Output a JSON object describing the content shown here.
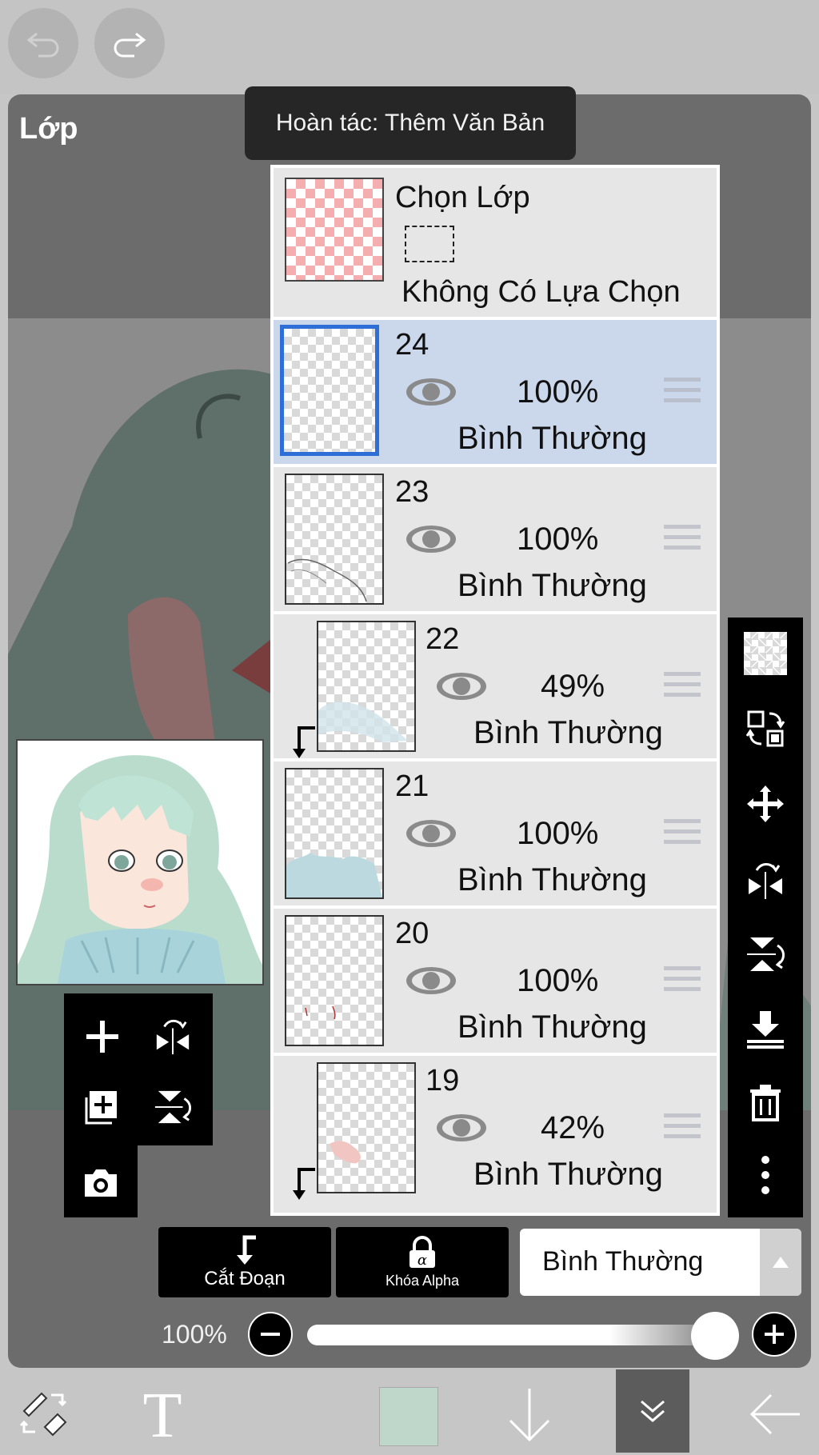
{
  "toolbar_top": {
    "undo_icon": "undo-icon",
    "redo_icon": "redo-icon"
  },
  "panel": {
    "title": "Lớp"
  },
  "tooltip": {
    "text": "Hoàn tác: Thêm Văn Bản"
  },
  "select_layer": {
    "title": "Chọn Lớp",
    "status": "Không Có Lựa Chọn"
  },
  "layers": [
    {
      "number": "24",
      "opacity": "100%",
      "blend_mode": "Bình Thường",
      "selected": true,
      "clipped": false
    },
    {
      "number": "23",
      "opacity": "100%",
      "blend_mode": "Bình Thường",
      "selected": false,
      "clipped": false
    },
    {
      "number": "22",
      "opacity": "49%",
      "blend_mode": "Bình Thường",
      "selected": false,
      "clipped": true
    },
    {
      "number": "21",
      "opacity": "100%",
      "blend_mode": "Bình Thường",
      "selected": false,
      "clipped": false
    },
    {
      "number": "20",
      "opacity": "100%",
      "blend_mode": "Bình Thường",
      "selected": false,
      "clipped": false
    },
    {
      "number": "19",
      "opacity": "42%",
      "blend_mode": "Bình Thường",
      "selected": false,
      "clipped": true
    }
  ],
  "right_toolbar": [
    "transparency-icon",
    "swap-layers-icon",
    "move-icon",
    "flip-horizontal-icon",
    "flip-vertical-icon",
    "merge-down-icon",
    "trash-icon",
    "more-icon"
  ],
  "left_tools": [
    "add-layer-icon",
    "flip-horizontal-icon",
    "add-copy-icon",
    "flip-vertical-icon",
    "camera-icon"
  ],
  "bottom_controls": {
    "clip_label": "Cắt Đoạn",
    "alpha_lock_label": "Khóa Alpha",
    "blend_mode": "Bình Thường",
    "opacity_label": "100%",
    "opacity_value": 1.0
  },
  "bottom_toolbar": {
    "color_swatch": "#bfd6cb",
    "icons": [
      "transform-tools-icon",
      "text-tool-icon",
      "color-swatch",
      "arrow-down-icon",
      "layers-collapse-icon",
      "back-icon"
    ]
  },
  "colors": {
    "selected_layer": "#cbd8ec",
    "selected_border": "#2d6fd6",
    "panel": "#6c6c6c"
  }
}
